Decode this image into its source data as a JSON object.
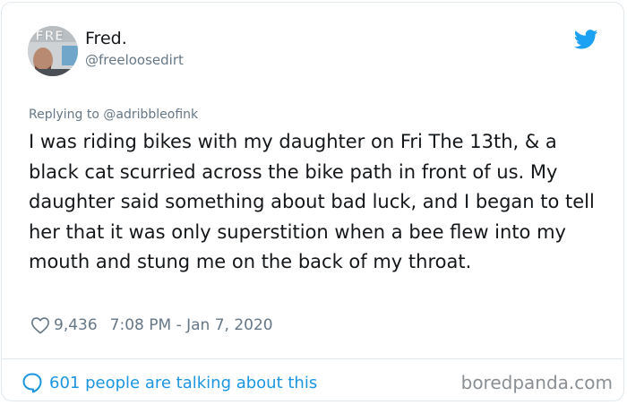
{
  "author": {
    "display_name": "Fred.",
    "handle": "@freeloosedirt",
    "avatar_text": "FRE"
  },
  "reply": {
    "replying_to": "Replying to @adribbleofink"
  },
  "tweet": {
    "text": "I was riding bikes with my daughter on Fri The 13th, & a black cat scurried across the bike path in front of us. My daughter said something about bad luck, and I began to tell her that it was only superstition when a bee flew into my mouth and stung me on the back of my throat."
  },
  "meta": {
    "likes": "9,436",
    "timestamp": "7:08 PM - Jan 7, 2020"
  },
  "footer": {
    "talking": "601 people are talking about this",
    "watermark": "boredpanda.com"
  },
  "icons": {
    "brand": "twitter-bird-icon",
    "like": "heart-icon",
    "conversation": "speech-bubble-icon"
  },
  "colors": {
    "twitter_blue": "#1da1f2",
    "link_blue": "#1b95e0",
    "secondary_text": "#657786",
    "border": "#e1e8ed"
  }
}
